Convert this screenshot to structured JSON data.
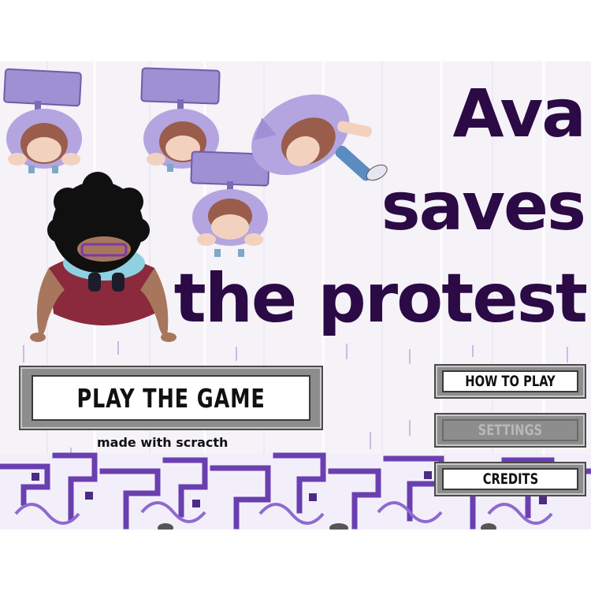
{
  "title": {
    "line1": "Ava",
    "line2": "saves",
    "line3": "the protest"
  },
  "menu": {
    "play_label": "PLAY THE GAME",
    "how_to_play_label": "HOW TO PLAY",
    "settings_label": "SETTINGS",
    "credits_label": "CREDITS"
  },
  "footer_note": "made with scracth",
  "colors": {
    "title": "#2b0a45",
    "hoodie": "#a695d6",
    "pattern": "#6a3fb0",
    "button_frame": "#8d8d8d"
  },
  "state": {
    "settings_enabled": false
  }
}
